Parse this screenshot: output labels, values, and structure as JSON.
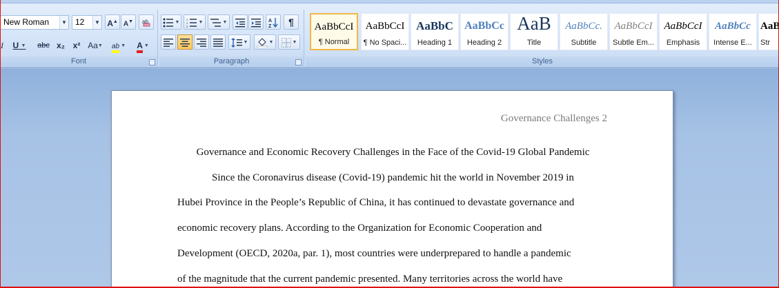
{
  "ribbon": {
    "font": {
      "label": "Font",
      "font_name": "New Roman",
      "font_size": "12",
      "grow": "A",
      "shrink": "A",
      "italic": "I",
      "underline": "U",
      "strikethrough": "abc",
      "subscript": "x₂",
      "superscript": "x²",
      "change_case": "Aa",
      "highlight": "ab",
      "font_color": "A"
    },
    "paragraph": {
      "label": "Paragraph",
      "pilcrow": "¶"
    },
    "styles": {
      "label": "Styles",
      "items": [
        {
          "sample": "AaBbCcI",
          "name": "¶ Normal"
        },
        {
          "sample": "AaBbCcI",
          "name": "¶ No Spaci..."
        },
        {
          "sample": "AaBbC",
          "name": "Heading 1"
        },
        {
          "sample": "AaBbCc",
          "name": "Heading 2"
        },
        {
          "sample": "AaB",
          "name": "Title"
        },
        {
          "sample": "AaBbCc.",
          "name": "Subtitle"
        },
        {
          "sample": "AaBbCcI",
          "name": "Subtle Em..."
        },
        {
          "sample": "AaBbCcI",
          "name": "Emphasis"
        },
        {
          "sample": "AaBbCc",
          "name": "Intense E..."
        },
        {
          "sample": "AaB",
          "name": "Str"
        }
      ]
    },
    "colors": {
      "highlight": "#ffff00",
      "font_color": "#e02020",
      "accent": "#f2b745"
    }
  },
  "document": {
    "header": "Governance Challenges 2",
    "title": "Governance and Economic Recovery Challenges in the Face of the Covid-19 Global Pandemic",
    "lines": [
      "Since the Coronavirus disease (Covid-19) pandemic hit the world in November 2019 in",
      "Hubei Province in the People’s Republic of China, it has continued to devastate governance and",
      "economic recovery plans.  According to the Organization for Economic Cooperation and",
      "Development (OECD, 2020a, par. 1), most countries were underprepared to handle a pandemic",
      "of the magnitude that the current pandemic presented. Many territories  across the world have"
    ]
  }
}
